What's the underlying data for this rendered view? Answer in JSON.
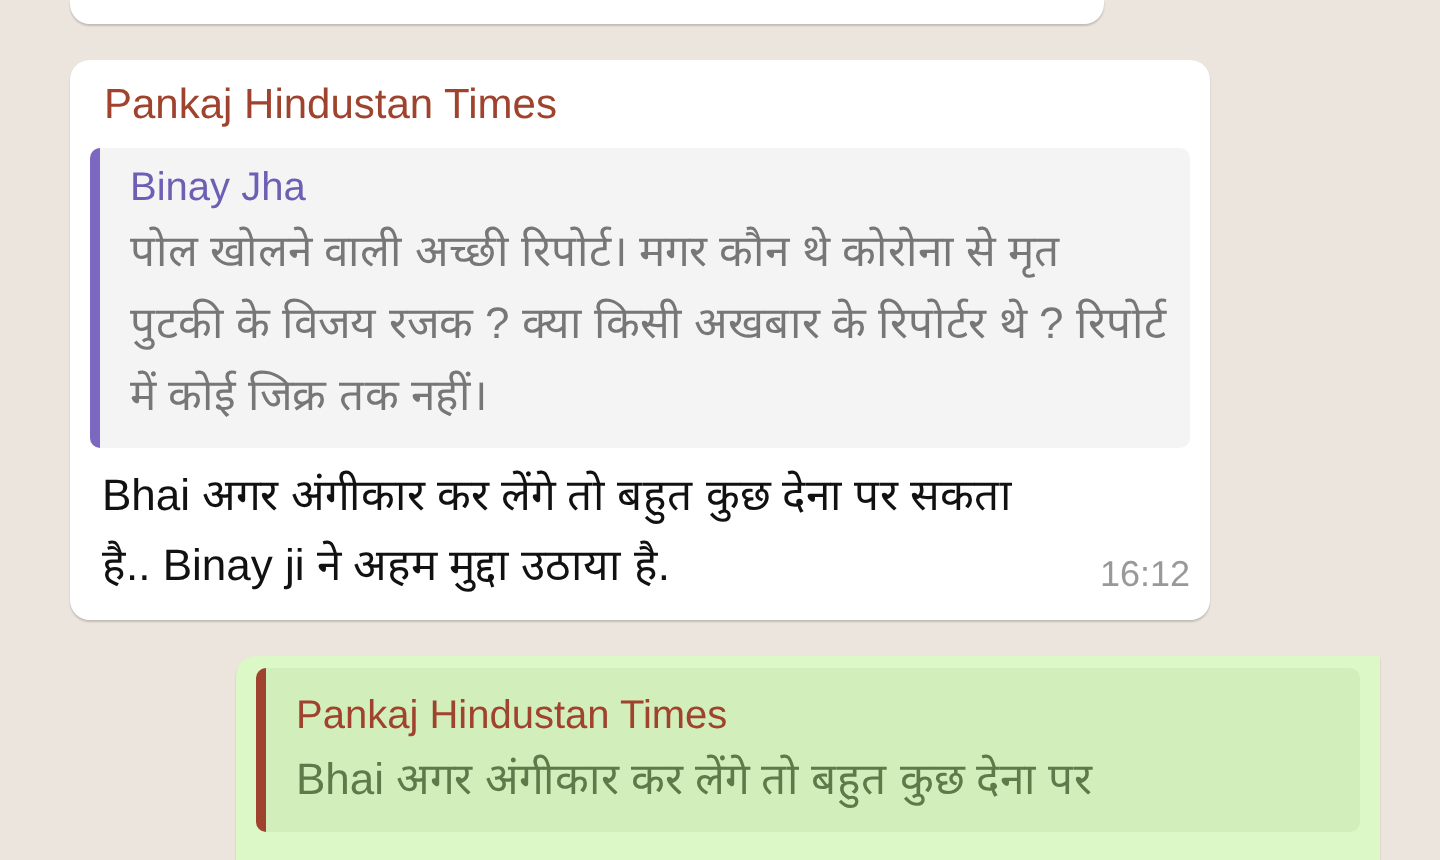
{
  "messages": [
    {
      "kind": "partial_incoming"
    },
    {
      "kind": "incoming",
      "sender": "Pankaj Hindustan Times",
      "quote": {
        "author": "Binay Jha",
        "text": "पोल खोलने वाली अच्छी रिपोर्ट। मगर कौन थे कोरोना से मृत पुटकी के विजय रजक ? क्या किसी अखबार के रिपोर्टर थे ? रिपोर्ट में कोई जिक्र तक नहीं।"
      },
      "text": "Bhai  अगर अंगीकार कर लेंगे तो बहुत कुछ देना पर सकता है.. Binay ji ने अहम मुद्दा उठाया है.",
      "time": "16:12"
    },
    {
      "kind": "outgoing",
      "quote": {
        "author": "Pankaj Hindustan Times",
        "text": "Bhai  अगर अंगीकार कर लेंगे तो बहुत कुछ देना पर"
      }
    }
  ]
}
